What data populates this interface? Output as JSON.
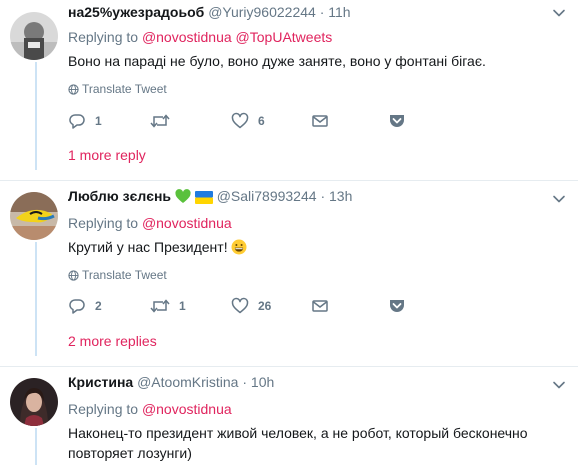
{
  "colors": {
    "accent": "#e0245e",
    "thread": "#cde3f5",
    "muted": "#657786"
  },
  "tweets": [
    {
      "name": "на25%ужезрадоьоб",
      "handle": "@Yuriy96022244",
      "dot": "·",
      "time": "11h",
      "replying_prefix": "Replying to",
      "mentions": [
        "@novostidnua",
        "@TopUAtweets"
      ],
      "text": "Воно на параді не було, воно дуже заняте, воно у фонтані бігає.",
      "translate": "Translate Tweet",
      "replies": "1",
      "retweets": "",
      "likes": "6",
      "more_replies": "1 more reply"
    },
    {
      "name": "Люблю зєлєнь",
      "name_emoji": [
        "green-heart-icon",
        "ukraine-flag-icon"
      ],
      "handle": "@Sali78993244",
      "dot": "·",
      "time": "13h",
      "replying_prefix": "Replying to",
      "mentions": [
        "@novostidnua"
      ],
      "text": "Крутий у нас Президент!",
      "text_emoji": "grinning-face-icon",
      "translate": "Translate Tweet",
      "replies": "2",
      "retweets": "1",
      "likes": "26",
      "more_replies": "2 more replies"
    },
    {
      "name": "Кристина",
      "handle": "@AtoomKristina",
      "dot": "·",
      "time": "10h",
      "replying_prefix": "Replying to",
      "mentions": [
        "@novostidnua"
      ],
      "text_line1": "Наконец-то президент живой человек, а не робот, который бесконечно",
      "text_line2": "повторяет лозунги)"
    }
  ]
}
